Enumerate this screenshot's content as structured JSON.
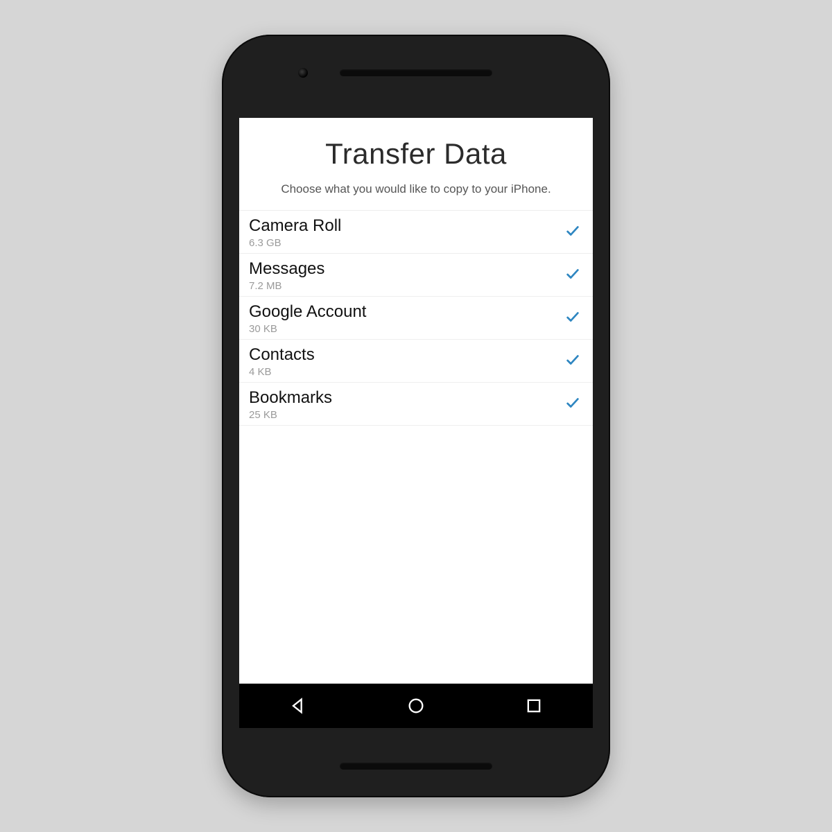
{
  "header": {
    "title": "Transfer Data",
    "subtitle": "Choose what you would like to copy to your iPhone."
  },
  "items": [
    {
      "label": "Camera Roll",
      "size": "6.3 GB",
      "selected": true
    },
    {
      "label": "Messages",
      "size": "7.2 MB",
      "selected": true
    },
    {
      "label": "Google Account",
      "size": "30 KB",
      "selected": true
    },
    {
      "label": "Contacts",
      "size": "4 KB",
      "selected": true
    },
    {
      "label": "Bookmarks",
      "size": "25 KB",
      "selected": true
    }
  ],
  "colors": {
    "accent": "#2e86c1"
  }
}
